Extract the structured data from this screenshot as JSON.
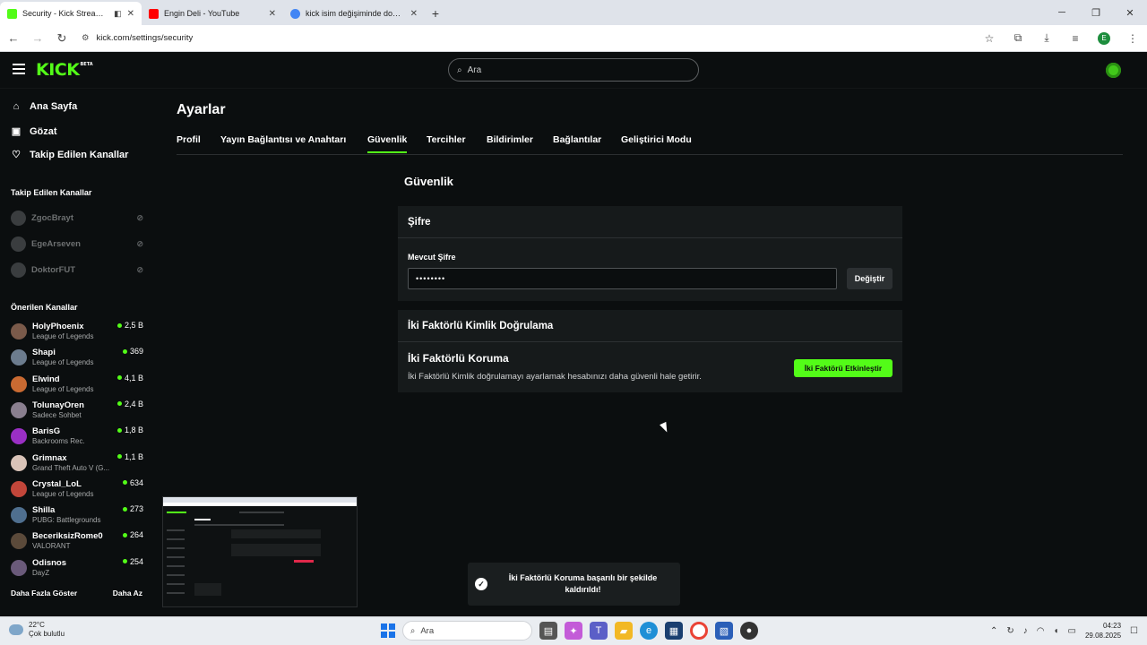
{
  "browser": {
    "tabs": [
      {
        "title": "Security - Kick Streaming",
        "favicon_color": "#53fc18",
        "active": true
      },
      {
        "title": "Engin Deli - YouTube",
        "favicon_color": "#ff0000",
        "active": false
      },
      {
        "title": "kick isim değişiminde doğrulam",
        "favicon_color": "#4285f4",
        "active": false
      }
    ],
    "url": "kick.com/settings/security",
    "profile_initial": "E"
  },
  "header": {
    "logo": "KICK",
    "logo_badge": "BETA",
    "search_placeholder": "Ara"
  },
  "sidebar": {
    "nav": [
      {
        "label": "Ana Sayfa",
        "icon": "home-icon"
      },
      {
        "label": "Gözat",
        "icon": "browse-icon"
      },
      {
        "label": "Takip Edilen Kanallar",
        "icon": "heart-icon"
      }
    ],
    "followed_title": "Takip Edilen Kanallar",
    "followed": [
      {
        "name": "ZgocBrayt"
      },
      {
        "name": "EgeArseven"
      },
      {
        "name": "DoktorFUT"
      }
    ],
    "recommended_title": "Önerilen Kanallar",
    "recommended": [
      {
        "name": "HolyPhoenix",
        "category": "League of Legends",
        "viewers": "2,5 B",
        "color": "#7a5a4a"
      },
      {
        "name": "Shapi",
        "category": "League of Legends",
        "viewers": "369",
        "color": "#6c7c8e"
      },
      {
        "name": "Elwind",
        "category": "League of Legends",
        "viewers": "4,1 B",
        "color": "#c96a32"
      },
      {
        "name": "TolunayOren",
        "category": "Sadece Sohbet",
        "viewers": "2,4 B",
        "color": "#8a7f8f"
      },
      {
        "name": "BarisG",
        "category": "Backrooms Rec.",
        "viewers": "1,8 B",
        "color": "#9a2fc4"
      },
      {
        "name": "Grimnax",
        "category": "Grand Theft Auto V (G...",
        "viewers": "1,1 B",
        "color": "#d9c3b8"
      },
      {
        "name": "Crystal_LoL",
        "category": "League of Legends",
        "viewers": "634",
        "color": "#c2463a"
      },
      {
        "name": "Shilla",
        "category": "PUBG: Battlegrounds",
        "viewers": "273",
        "color": "#4f6f8f"
      },
      {
        "name": "BeceriksizRome0",
        "category": "VALORANT",
        "viewers": "264",
        "color": "#5b4a3a"
      },
      {
        "name": "Odisnos",
        "category": "DayZ",
        "viewers": "254",
        "color": "#6a5a7a"
      }
    ],
    "show_more": "Daha Fazla Göster",
    "show_less": "Daha Az"
  },
  "settings": {
    "title": "Ayarlar",
    "tabs": [
      "Profil",
      "Yayın Bağlantısı ve Anahtarı",
      "Güvenlik",
      "Tercihler",
      "Bildirimler",
      "Bağlantılar",
      "Geliştirici Modu"
    ],
    "active_tab": "Güvenlik",
    "section_title": "Güvenlik",
    "password_card": {
      "title": "Şifre",
      "label": "Mevcut Şifre",
      "value": "••••••••",
      "button": "Değiştir"
    },
    "twofa_card": {
      "title": "İki Faktörlü Kimlik Doğrulama",
      "subtitle": "İki Faktörlü Koruma",
      "description": "İki Faktörlü Kimlik doğrulamayı ayarlamak hesabınızı daha güvenli hale getirir.",
      "button": "İki Faktörü Etkinleştir"
    }
  },
  "toast": {
    "message": "İki Faktörlü Koruma başarılı bir şekilde kaldırıldı!"
  },
  "taskbar": {
    "temperature": "22°C",
    "weather": "Çok bulutlu",
    "search": "Ara",
    "time": "04:23",
    "date": "29.08.2025"
  },
  "colors": {
    "accent": "#53fc18",
    "background": "#0b0e0f",
    "card": "#161a1b"
  }
}
